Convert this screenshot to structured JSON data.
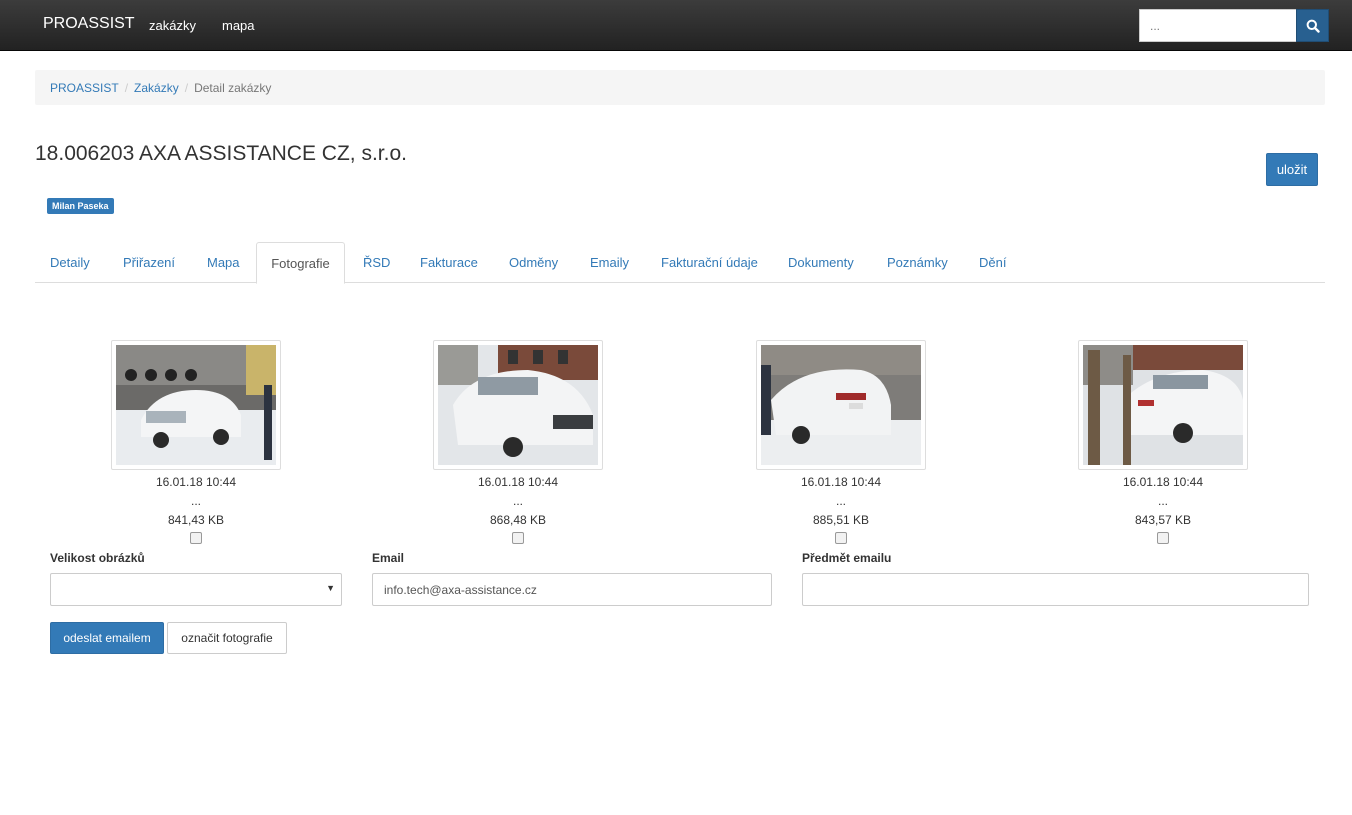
{
  "navbar": {
    "brand": "PROASSIST",
    "links": [
      "zakázky",
      "mapa"
    ],
    "search_placeholder": "...",
    "search_icon": "search-icon"
  },
  "breadcrumb": {
    "items": [
      "PROASSIST",
      "Zakázky"
    ],
    "active": "Detail zakázky"
  },
  "order": {
    "title": "18.006203 AXA ASSISTANCE CZ, s.r.o.",
    "save_label": "uložit",
    "assignee": "Milan Paseka"
  },
  "tabs": [
    "Detaily",
    "Přiřazení",
    "Mapa",
    "Fotografie",
    "ŘSD",
    "Fakturace",
    "Odměny",
    "Emaily",
    "Fakturační údaje",
    "Dokumenty",
    "Poznámky",
    "Dění"
  ],
  "active_tab": "Fotografie",
  "photos": [
    {
      "date": "16.01.18 10:44",
      "desc": "...",
      "size": "841,43 KB"
    },
    {
      "date": "16.01.18 10:44",
      "desc": "...",
      "size": "868,48 KB"
    },
    {
      "date": "16.01.18 10:44",
      "desc": "...",
      "size": "885,51 KB"
    },
    {
      "date": "16.01.18 10:44",
      "desc": "...",
      "size": "843,57 KB"
    }
  ],
  "form": {
    "size_label": "Velikost obrázků",
    "size_value": "",
    "email_label": "Email",
    "email_value": "info.tech@axa-assistance.cz",
    "subject_label": "Předmět emailu",
    "subject_value": "",
    "send_label": "odeslat emailem",
    "mark_label": "označit fotografie"
  },
  "colors": {
    "primary": "#337ab7",
    "navbar": "#222222"
  }
}
